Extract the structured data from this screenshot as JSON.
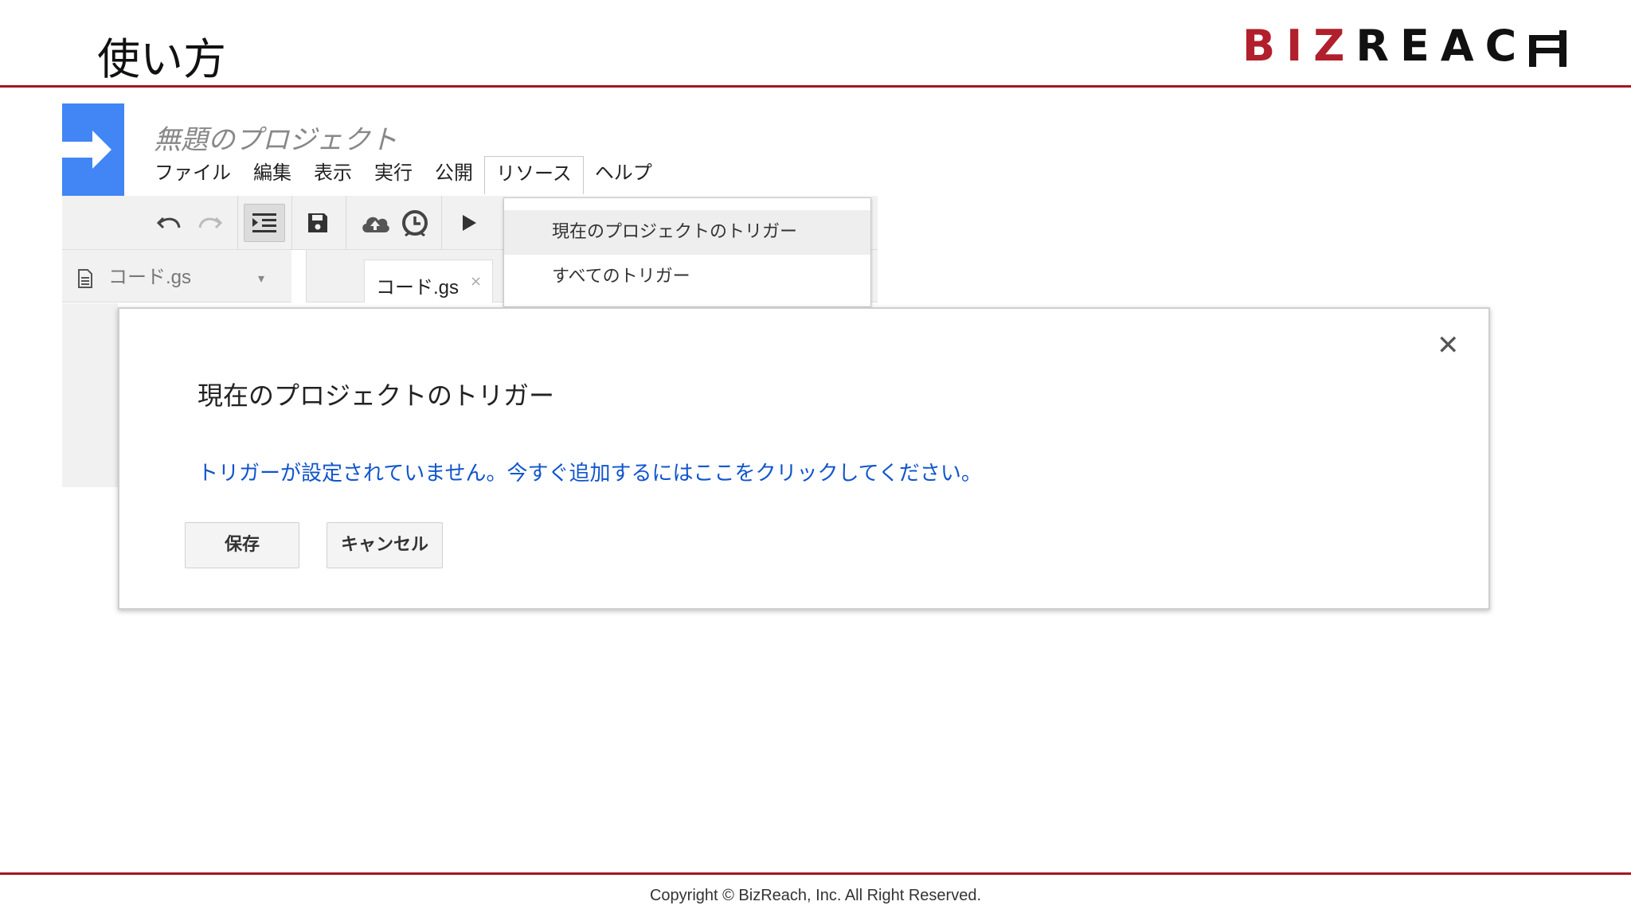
{
  "slide": {
    "title": "使い方",
    "logo_red": "BIZ",
    "logo_black": "REAC",
    "copyright": "Copyright © BizReach, Inc. All Right Reserved."
  },
  "editor": {
    "project_title": "無題のプロジェクト",
    "menu": [
      "ファイル",
      "編集",
      "表示",
      "実行",
      "公開",
      "リソース",
      "ヘルプ"
    ],
    "active_menu": "リソース",
    "file_name": "コード.gs",
    "tab_name": "コード.gs",
    "tab_close": "×",
    "caret": "▾",
    "toolbar_icons": [
      "undo-icon",
      "redo-icon",
      "indent-icon",
      "save-icon",
      "cloud-icon",
      "clock-icon",
      "run-icon"
    ]
  },
  "dropdown": {
    "items": [
      "現在のプロジェクトのトリガー",
      "すべてのトリガー"
    ],
    "highlighted": "現在のプロジェクトのトリガー"
  },
  "dialog": {
    "close": "✕",
    "title": "現在のプロジェクトのトリガー",
    "message": "トリガーが設定されていません。今すぐ追加するにはここをクリックしてください。",
    "save_label": "保存",
    "cancel_label": "キャンセル"
  },
  "colors": {
    "brand_red": "#a31621",
    "apps_blue": "#4285f4",
    "link_blue": "#1155cc"
  }
}
